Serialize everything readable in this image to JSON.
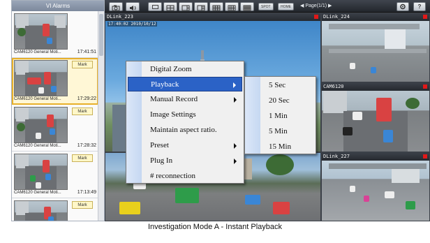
{
  "alarm_panel": {
    "title": "VI Alarms",
    "mark_label": "Mark",
    "items": [
      {
        "camera": "CAM6120",
        "label": "General Moti...",
        "time": "17:41:51",
        "has_mark": false,
        "selected": false
      },
      {
        "camera": "CAM6120",
        "label": "General Moti...",
        "time": "17:29:22",
        "has_mark": true,
        "selected": true
      },
      {
        "camera": "CAM6120",
        "label": "General Moti...",
        "time": "17:28:32",
        "has_mark": true,
        "selected": false
      },
      {
        "camera": "CAM6120",
        "label": "General Moti...",
        "time": "17:13:49",
        "has_mark": true,
        "selected": false
      },
      {
        "camera": "",
        "label": "",
        "time": "",
        "has_mark": true,
        "selected": false
      }
    ]
  },
  "toolbar": {
    "spot_label": "SPOT",
    "home_label": "HOME",
    "page_label": "Page(1/1)"
  },
  "tiles": {
    "main": {
      "title": "DLink_223",
      "timestamp": "17:40:02 2010/10/12"
    },
    "top_right": {
      "title": "DLink_224"
    },
    "mid_right": {
      "title": "CAM6120"
    },
    "bottom_right": {
      "title": "DLink_227"
    }
  },
  "context_menu": {
    "items": [
      {
        "label": "Digital Zoom",
        "has_submenu": false,
        "active": false
      },
      {
        "label": "Playback",
        "has_submenu": true,
        "active": true
      },
      {
        "label": "Manual Record",
        "has_submenu": true,
        "active": false
      },
      {
        "label": "Image Settings",
        "has_submenu": false,
        "active": false
      },
      {
        "label": "Maintain aspect ratio.",
        "has_submenu": false,
        "active": false
      },
      {
        "label": "Preset",
        "has_submenu": true,
        "active": false
      },
      {
        "label": "Plug In",
        "has_submenu": true,
        "active": false
      },
      {
        "label": "# reconnection",
        "has_submenu": false,
        "active": false
      }
    ],
    "playback_submenu": [
      "5 Sec",
      "20 Sec",
      "1 Min",
      "5 Min",
      "15 Min"
    ]
  },
  "caption": "Investigation Mode A - Instant Playback",
  "colors": {
    "menu_highlight": "#2b62c6",
    "record_indicator": "#e01818",
    "selected_alarm_border": "#e8b02a"
  }
}
